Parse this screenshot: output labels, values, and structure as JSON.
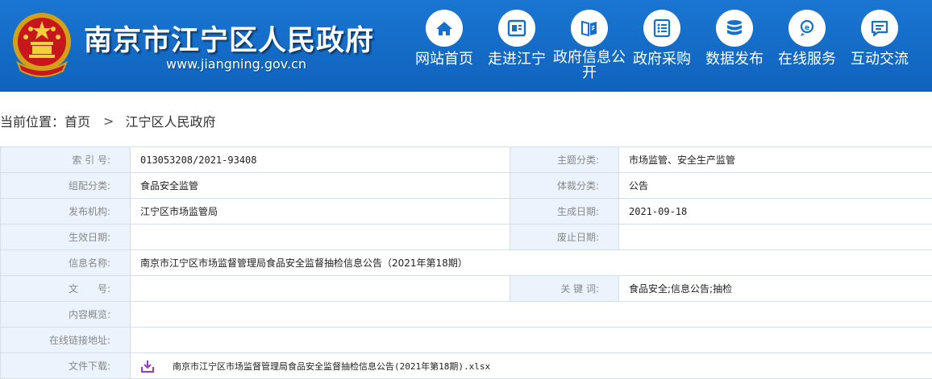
{
  "header": {
    "title": "南京市江宁区人民政府",
    "url": "www.jiangning.gov.cn",
    "nav": [
      {
        "label": "网站首页",
        "icon": "home-icon"
      },
      {
        "label": "走进江宁",
        "icon": "window-icon"
      },
      {
        "label": "政府信息公开",
        "icon": "book-icon"
      },
      {
        "label": "政府采购",
        "icon": "list-icon"
      },
      {
        "label": "数据发布",
        "icon": "database-icon"
      },
      {
        "label": "在线服务",
        "icon": "service-icon"
      },
      {
        "label": "互动交流",
        "icon": "chat-icon"
      }
    ]
  },
  "breadcrumb": {
    "prefix": "当前位置：",
    "home": "首页",
    "separator": ">",
    "current": "江宁区人民政府"
  },
  "info": {
    "index_label": "索 引 号:",
    "index_value": "013053208/2021-93408",
    "topic_label": "主题分类:",
    "topic_value": "市场监管、安全生产监管",
    "group_label": "组配分类:",
    "group_value": "食品安全监管",
    "genre_label": "体裁分类:",
    "genre_value": "公告",
    "publisher_label": "发布机构:",
    "publisher_value": "江宁区市场监管局",
    "created_label": "生成日期:",
    "created_value": "2021-09-18",
    "effective_label": "生效日期:",
    "effective_value": "",
    "expired_label": "废止日期:",
    "expired_value": "",
    "name_label": "信息名称:",
    "name_value": "南京市江宁区市场监督管理局食品安全监督抽检信息公告（2021年第18期）",
    "docno_label": "文　　号:",
    "docno_value": "",
    "keywords_label": "关 键 词:",
    "keywords_value": "食品安全;信息公告;抽检",
    "summary_label": "内容概览:",
    "summary_value": "",
    "link_label": "在线链接地址:",
    "link_value": "",
    "download_label": "文件下载:",
    "download_file": "南京市江宁区市场监督管理局食品安全监督抽检信息公告(2021年第18期).xlsx"
  },
  "colors": {
    "header_bg": "#1470cc",
    "label_bg": "#ebf3fc",
    "border": "#d7dde5",
    "download_icon": "#8e3fc6"
  }
}
